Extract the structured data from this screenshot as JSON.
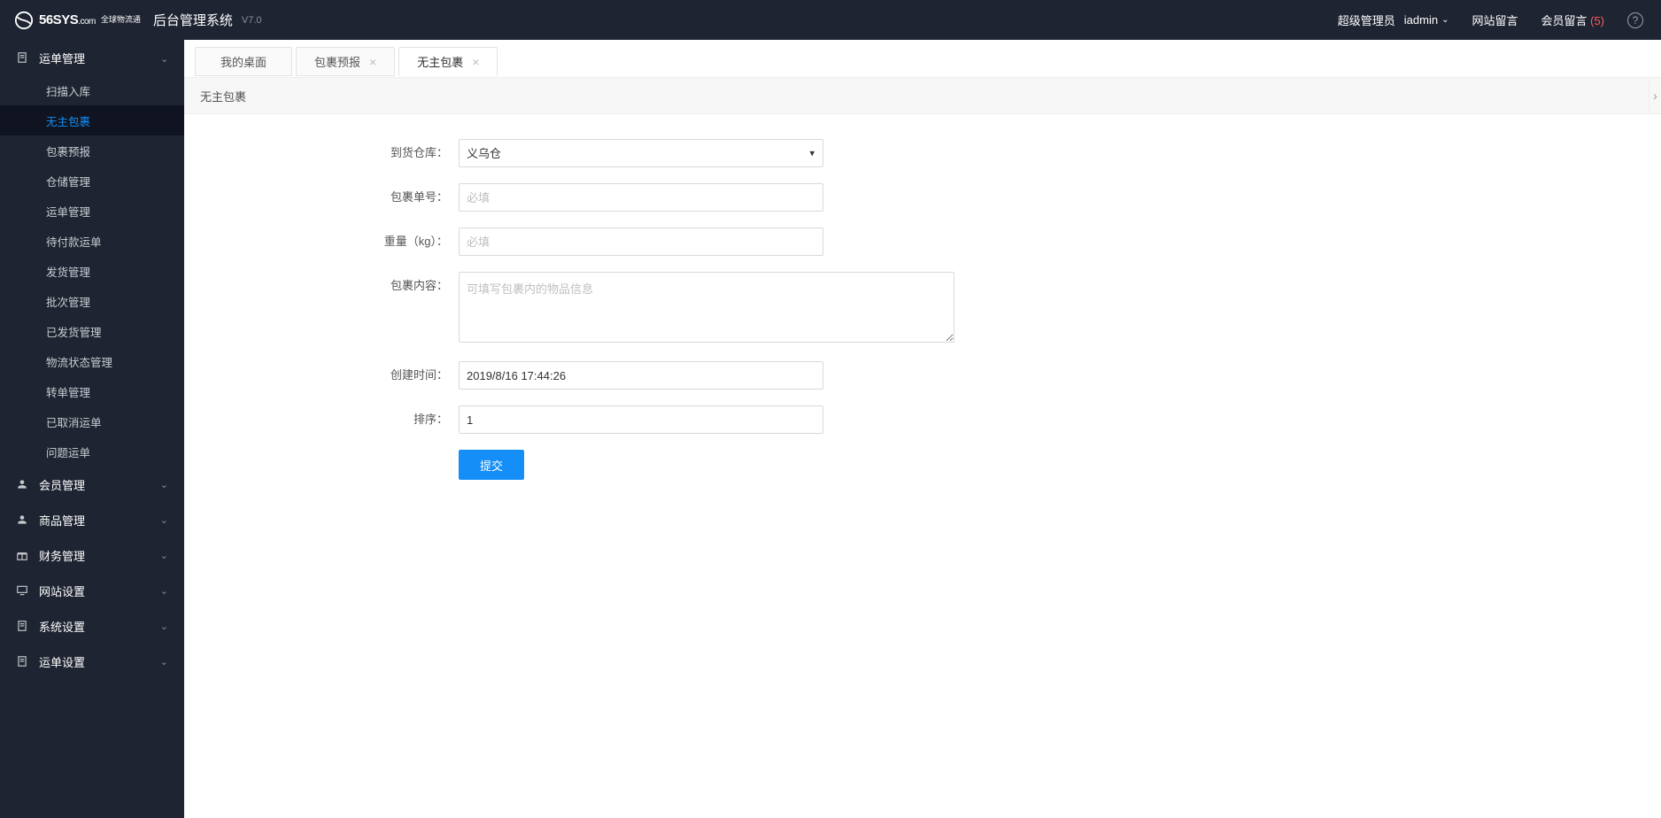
{
  "header": {
    "brand_main": "56SYS",
    "brand_suffix": ".com",
    "brand_tag": "全球物流通",
    "system_title": "后台管理系统",
    "version": "V7.0",
    "role_label": "超级管理员",
    "username": "iadmin",
    "nav_site_msg": "网站留言",
    "nav_member_msg": "会员留言",
    "member_msg_count": "(5)"
  },
  "sidebar": {
    "groups": [
      {
        "key": "waybill",
        "label": "运单管理",
        "icon": "doc",
        "open": true,
        "items": [
          {
            "key": "scan-in",
            "label": "扫描入库"
          },
          {
            "key": "unowned",
            "label": "无主包裹",
            "active": true
          },
          {
            "key": "forecast",
            "label": "包裹预报"
          },
          {
            "key": "storage",
            "label": "仓储管理"
          },
          {
            "key": "waybill-mgmt",
            "label": "运单管理"
          },
          {
            "key": "unpaid",
            "label": "待付款运单"
          },
          {
            "key": "ship",
            "label": "发货管理"
          },
          {
            "key": "batch",
            "label": "批次管理"
          },
          {
            "key": "shipped",
            "label": "已发货管理"
          },
          {
            "key": "logistics",
            "label": "物流状态管理"
          },
          {
            "key": "transfer",
            "label": "转单管理"
          },
          {
            "key": "canceled",
            "label": "已取消运单"
          },
          {
            "key": "problem",
            "label": "问题运单"
          }
        ]
      },
      {
        "key": "member",
        "label": "会员管理",
        "icon": "user",
        "open": false,
        "items": []
      },
      {
        "key": "goods",
        "label": "商品管理",
        "icon": "user",
        "open": false,
        "items": []
      },
      {
        "key": "finance",
        "label": "财务管理",
        "icon": "gift",
        "open": false,
        "items": []
      },
      {
        "key": "site",
        "label": "网站设置",
        "icon": "monitor",
        "open": false,
        "items": []
      },
      {
        "key": "system",
        "label": "系统设置",
        "icon": "doc",
        "open": false,
        "items": []
      },
      {
        "key": "waybill-set",
        "label": "运单设置",
        "icon": "doc",
        "open": false,
        "items": []
      }
    ]
  },
  "tabs": [
    {
      "key": "desktop",
      "label": "我的桌面",
      "closable": false,
      "active": false
    },
    {
      "key": "forecast",
      "label": "包裹预报",
      "closable": true,
      "active": false
    },
    {
      "key": "unowned",
      "label": "无主包裹",
      "closable": true,
      "active": true
    }
  ],
  "page": {
    "title": "无主包裹"
  },
  "form": {
    "warehouse": {
      "label": "到货仓库：",
      "value": "义乌仓"
    },
    "package_no": {
      "label": "包裹单号：",
      "placeholder": "必填",
      "value": ""
    },
    "weight": {
      "label": "重量（kg）：",
      "placeholder": "必填",
      "value": ""
    },
    "content": {
      "label": "包裹内容：",
      "placeholder": "可填写包裹内的物品信息",
      "value": ""
    },
    "created": {
      "label": "创建时间：",
      "value": "2019/8/16 17:44:26"
    },
    "sort": {
      "label": "排序：",
      "value": "1"
    },
    "submit_label": "提交"
  }
}
